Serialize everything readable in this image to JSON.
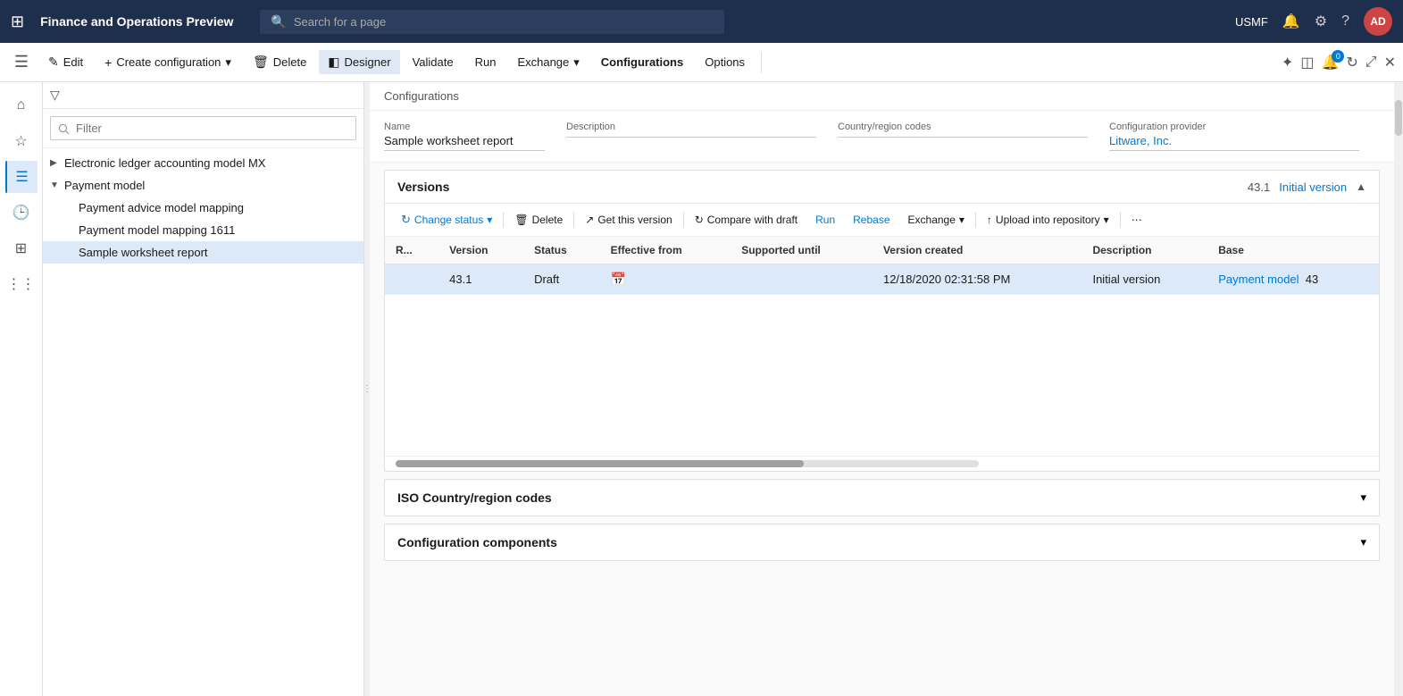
{
  "app": {
    "title": "Finance and Operations Preview",
    "search_placeholder": "Search for a page"
  },
  "topnav": {
    "user_label": "USMF",
    "avatar_text": "AD"
  },
  "cmdbar": {
    "edit_label": "Edit",
    "create_config_label": "Create configuration",
    "delete_label": "Delete",
    "designer_label": "Designer",
    "validate_label": "Validate",
    "run_label": "Run",
    "exchange_label": "Exchange",
    "configurations_label": "Configurations",
    "options_label": "Options",
    "notification_count": "0"
  },
  "tree": {
    "filter_placeholder": "Filter",
    "items": [
      {
        "label": "Electronic ledger accounting model MX",
        "level": 0,
        "expandable": true,
        "expanded": false
      },
      {
        "label": "Payment model",
        "level": 0,
        "expandable": true,
        "expanded": true
      },
      {
        "label": "Payment advice model mapping",
        "level": 1,
        "expandable": false
      },
      {
        "label": "Payment model mapping 1611",
        "level": 1,
        "expandable": false
      },
      {
        "label": "Sample worksheet report",
        "level": 1,
        "expandable": false,
        "selected": true
      }
    ]
  },
  "breadcrumb": "Configurations",
  "config": {
    "name_label": "Name",
    "name_value": "Sample worksheet report",
    "description_label": "Description",
    "description_value": "",
    "country_label": "Country/region codes",
    "country_value": "",
    "provider_label": "Configuration provider",
    "provider_value": "Litware, Inc."
  },
  "versions": {
    "section_title": "Versions",
    "version_number": "43.1",
    "version_status": "Initial version",
    "toolbar": {
      "change_status_label": "Change status",
      "delete_label": "Delete",
      "get_version_label": "Get this version",
      "compare_draft_label": "Compare with draft",
      "run_label": "Run",
      "rebase_label": "Rebase",
      "exchange_label": "Exchange",
      "upload_label": "Upload into repository"
    },
    "table": {
      "columns": [
        "R...",
        "Version",
        "Status",
        "Effective from",
        "Supported until",
        "Version created",
        "Description",
        "Base"
      ],
      "rows": [
        {
          "r": "",
          "version": "43.1",
          "status": "Draft",
          "effective_from": "",
          "supported_until": "",
          "version_created": "12/18/2020 02:31:58 PM",
          "description": "Initial version",
          "base": "Payment model",
          "base_num": "43"
        }
      ]
    }
  },
  "iso_section": {
    "title": "ISO Country/region codes"
  },
  "components_section": {
    "title": "Configuration components"
  }
}
